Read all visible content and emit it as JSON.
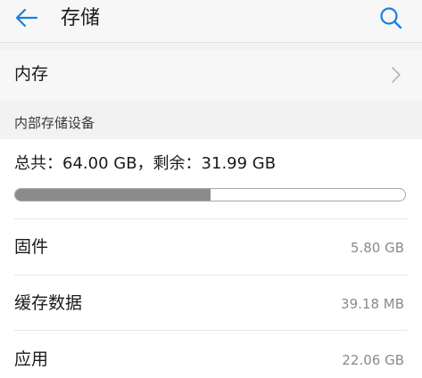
{
  "header": {
    "title": "存储",
    "back_icon": "arrow-left-icon",
    "search_icon": "search-icon",
    "accent_color": "#1a7fe0"
  },
  "memory_row": {
    "label": "内存",
    "chevron_icon": "chevron-right-icon"
  },
  "internal_storage": {
    "section_title": "内部存储设备",
    "summary": "总共：64.00 GB，剩余：31.99 GB",
    "used_fraction": 0.5001,
    "bar_fill_color": "#8a8a8a",
    "items": [
      {
        "label": "固件",
        "value": "5.80 GB"
      },
      {
        "label": "缓存数据",
        "value": "39.18 MB"
      },
      {
        "label": "应用",
        "value": "22.06 GB"
      }
    ]
  }
}
